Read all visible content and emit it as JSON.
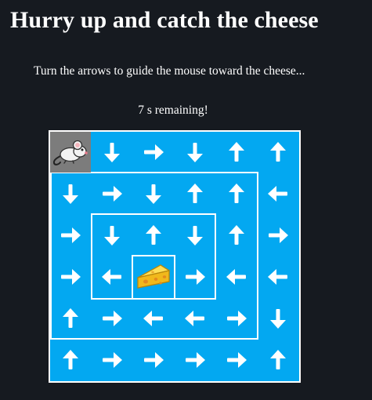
{
  "header": {
    "title": "Hurry up and catch the cheese",
    "instructions": "Turn the arrows to guide the mouse toward the cheese...",
    "timer_text": "7 s remaining!"
  },
  "colors": {
    "background": "#161a20",
    "board": "#03a8f1",
    "mouse_cell": "#7c7c7c",
    "arrow": "#ffffff",
    "text": "#ffffff"
  },
  "board": {
    "rows": 6,
    "cols": 6,
    "grid": [
      [
        "mouse",
        "down",
        "right",
        "down",
        "up",
        "up"
      ],
      [
        "down",
        "right",
        "down",
        "up",
        "up",
        "left"
      ],
      [
        "right",
        "down",
        "up",
        "down",
        "up",
        "right"
      ],
      [
        "right",
        "left",
        "cheese",
        "right",
        "left",
        "left"
      ],
      [
        "up",
        "right",
        "left",
        "left",
        "right",
        "down"
      ],
      [
        "up",
        "right",
        "right",
        "right",
        "right",
        "up"
      ]
    ],
    "icons": {
      "mouse": "mouse-icon",
      "cheese": "cheese-icon",
      "arrow": "arrow-icon"
    }
  }
}
